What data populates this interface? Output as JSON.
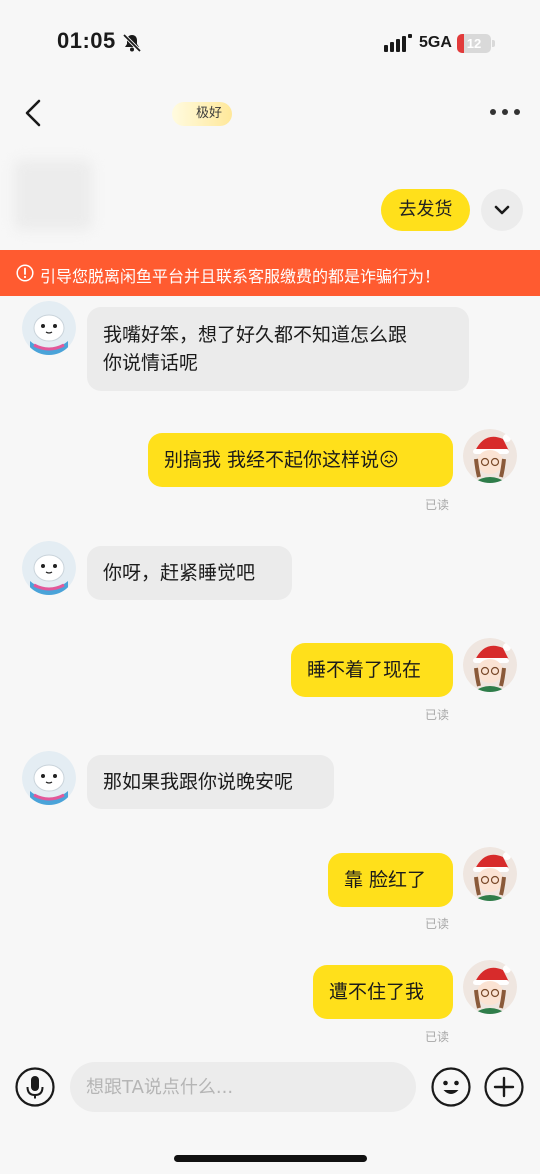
{
  "status_bar": {
    "time": "01:05",
    "network": "5GA",
    "battery": "12",
    "battery_level_percent": 12,
    "battery_color": "#e23b3b"
  },
  "header": {
    "title": "",
    "reputation_badge": "极好"
  },
  "item_card": {
    "ship_button": "去发货"
  },
  "warning": {
    "text": "引导您脱离闲鱼平台并且联系客服缴费的都是诈骗行为！",
    "color": "#ff5b30"
  },
  "messages": [
    {
      "side": "in",
      "lines": [
        "我嘴好笨，想了好久都不知道怎么跟",
        "你说情话呢"
      ]
    },
    {
      "side": "out",
      "lines": [
        "别搞我 我经不起你这样说"
      ],
      "emoji": "😖",
      "status": "已读"
    },
    {
      "side": "in",
      "lines": [
        "你呀，赶紧睡觉吧"
      ]
    },
    {
      "side": "out",
      "lines": [
        "睡不着了现在"
      ],
      "status": "已读"
    },
    {
      "side": "in",
      "lines": [
        "那如果我跟你说晚安呢"
      ]
    },
    {
      "side": "out",
      "lines": [
        "靠 脸红了"
      ],
      "status": "已读"
    },
    {
      "side": "out",
      "lines": [
        "遭不住了我"
      ],
      "status": "已读"
    }
  ],
  "input_bar": {
    "placeholder": "想跟TA说点什么...",
    "value": ""
  },
  "icons": {
    "voice": "microphone-icon",
    "emoji": "smiley-icon",
    "add": "plus-icon"
  },
  "colors": {
    "accent": "#ffe01b",
    "incoming_bubble": "#ebebeb",
    "background": "#f7f7f7"
  }
}
